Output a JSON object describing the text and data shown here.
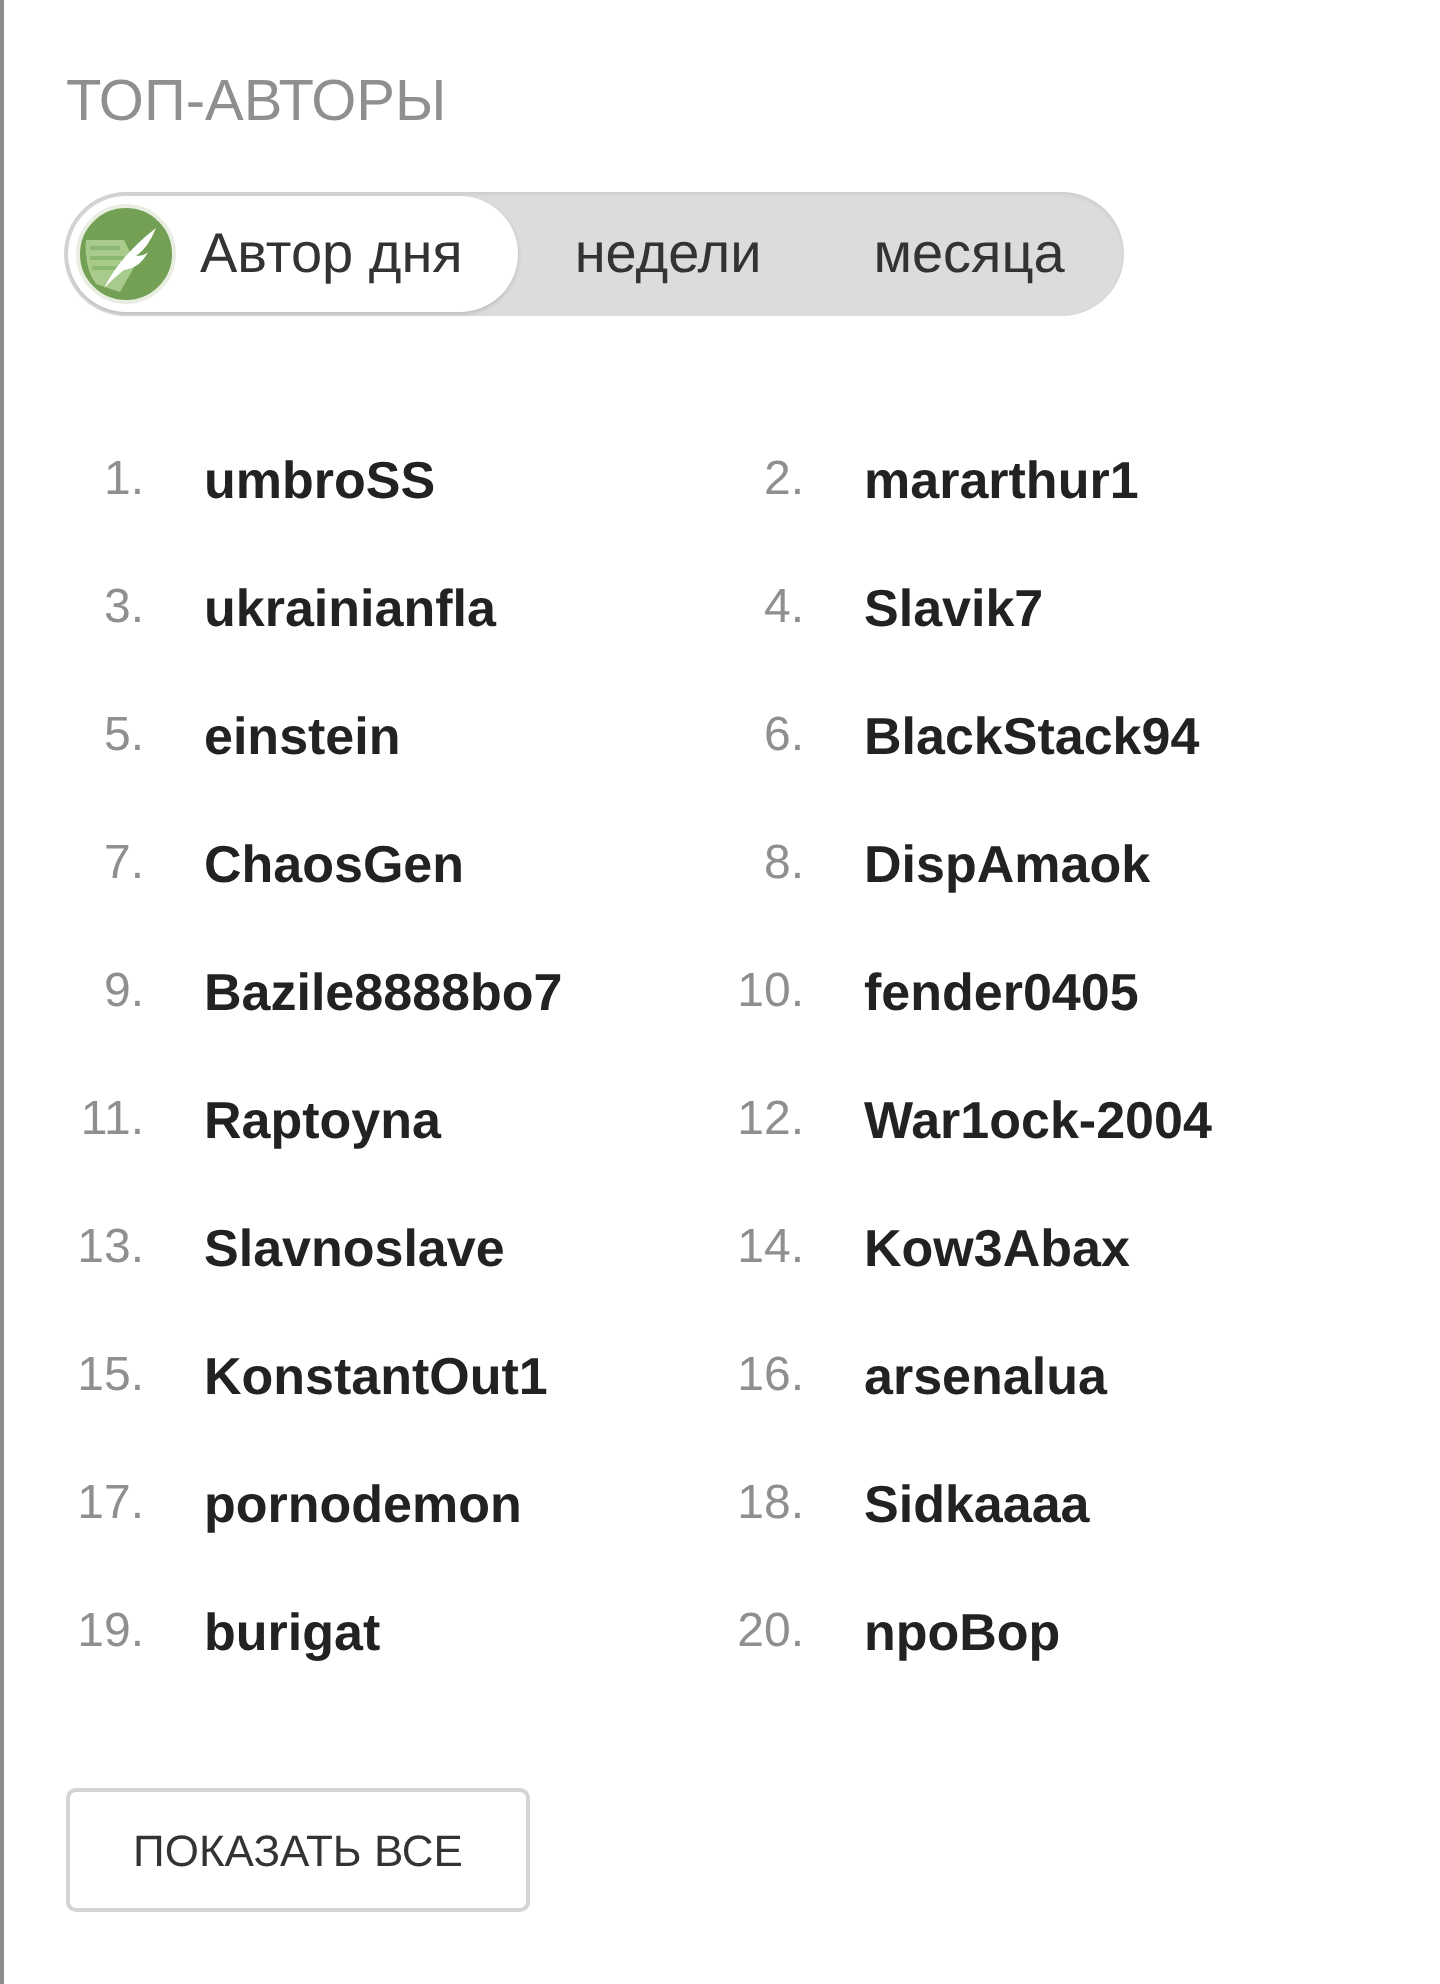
{
  "section": {
    "title": "ТОП-АВТОРЫ"
  },
  "period_tabs": [
    {
      "label": "Автор дня",
      "selected": true
    },
    {
      "label": "недели",
      "selected": false
    },
    {
      "label": "месяца",
      "selected": false
    }
  ],
  "authors": [
    {
      "rank": "1.",
      "name": "umbroSS"
    },
    {
      "rank": "2.",
      "name": "mararthur1"
    },
    {
      "rank": "3.",
      "name": "ukrainianfla"
    },
    {
      "rank": "4.",
      "name": "Slavik7"
    },
    {
      "rank": "5.",
      "name": "einstein"
    },
    {
      "rank": "6.",
      "name": "BlackStack94"
    },
    {
      "rank": "7.",
      "name": "ChaosGen"
    },
    {
      "rank": "8.",
      "name": "DispAmaok"
    },
    {
      "rank": "9.",
      "name": "Bazile8888bo7"
    },
    {
      "rank": "10.",
      "name": "fender0405"
    },
    {
      "rank": "11.",
      "name": "Raptoyna"
    },
    {
      "rank": "12.",
      "name": "War1ock-2004"
    },
    {
      "rank": "13.",
      "name": "Slavnoslave"
    },
    {
      "rank": "14.",
      "name": "Kow3Abax"
    },
    {
      "rank": "15.",
      "name": "KonstantOut1"
    },
    {
      "rank": "16.",
      "name": "arsenalua"
    },
    {
      "rank": "17.",
      "name": "pornodemon"
    },
    {
      "rank": "18.",
      "name": "Sidkaaaa"
    },
    {
      "rank": "19.",
      "name": "burigat"
    },
    {
      "rank": "20.",
      "name": "npoBop"
    }
  ],
  "show_all_button": {
    "label": "ПОКАЗАТЬ ВСЕ"
  }
}
